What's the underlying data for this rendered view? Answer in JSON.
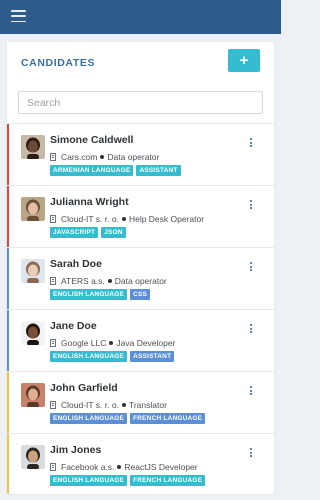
{
  "topbar": {
    "menu_icon": "hamburger-icon"
  },
  "panel": {
    "title": "CANDIDATES",
    "add_button_label": "+",
    "search_placeholder": "Search"
  },
  "candidates": [
    {
      "name": "Simone Caldwell",
      "company": "Cars.com",
      "role": "Data operator",
      "stripe_color": "#e2453c",
      "tags": [
        {
          "label": "ARMENIAN LANGUAGE",
          "color": "teal"
        },
        {
          "label": "ASSISTANT",
          "color": "teal"
        }
      ],
      "avatar": {
        "bg": "#c8b8a8",
        "hair": "#2a1c14",
        "skin": "#6b4a36"
      }
    },
    {
      "name": "Julianna Wright",
      "company": "Cloud-IT s. r. o.",
      "role": "Help Desk Operator",
      "stripe_color": "#e2453c",
      "tags": [
        {
          "label": "JAVASCRIPT",
          "color": "teal"
        },
        {
          "label": "JSON",
          "color": "teal"
        }
      ],
      "avatar": {
        "bg": "#b9a48a",
        "hair": "#6b4f33",
        "skin": "#e3bfa3"
      }
    },
    {
      "name": "Sarah Doe",
      "company": "ATERS a.s.",
      "role": "Data operator",
      "stripe_color": "#5b8fd6",
      "tags": [
        {
          "label": "ENGLISH LANGUAGE",
          "color": "teal"
        },
        {
          "label": "CSS",
          "color": "blue"
        }
      ],
      "avatar": {
        "bg": "#dfe5ec",
        "hair": "#8a6a52",
        "skin": "#eccdb6"
      }
    },
    {
      "name": "Jane Doe",
      "company": "Google LLC",
      "role": "Java Developer",
      "stripe_color": "#5b8fd6",
      "tags": [
        {
          "label": "ENGLISH LANGUAGE",
          "color": "teal"
        },
        {
          "label": "ASSISTANT",
          "color": "blue"
        }
      ],
      "avatar": {
        "bg": "#f3f3f3",
        "hair": "#1e140e",
        "skin": "#7a4f36"
      }
    },
    {
      "name": "John Garfield",
      "company": "Cloud-IT s. r. o.",
      "role": "Translator",
      "stripe_color": "#f5c342",
      "tags": [
        {
          "label": "ENGLISH LANGUAGE",
          "color": "blue"
        },
        {
          "label": "FRENCH LANGUAGE",
          "color": "blue"
        }
      ],
      "avatar": {
        "bg": "#c9826a",
        "hair": "#5b3a2a",
        "skin": "#e1ad90"
      }
    },
    {
      "name": "Jim Jones",
      "company": "Facebook a.s.",
      "role": "ReactJS Developer",
      "stripe_color": "#f5c342",
      "tags": [
        {
          "label": "ENGLISH LANGUAGE",
          "color": "teal"
        },
        {
          "label": "FRENCH LANGUAGE",
          "color": "teal"
        }
      ],
      "avatar": {
        "bg": "#d9dcdf",
        "hair": "#2b2622",
        "skin": "#caa27f"
      }
    }
  ]
}
